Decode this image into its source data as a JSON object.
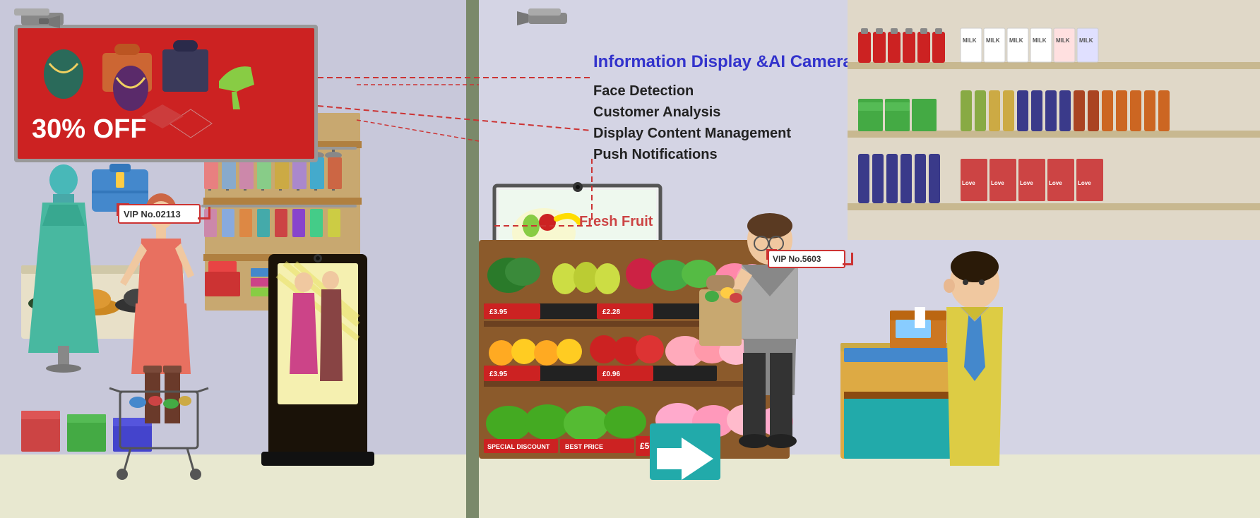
{
  "left_panel": {
    "bg_color": "#c8c8da",
    "floor_color": "#e8e8d0",
    "discount_text": "30% OFF",
    "vip_text": "VIP No.02113",
    "features_label": "Information Display &AI Camera"
  },
  "right_panel": {
    "bg_color": "#d4d4e4",
    "floor_color": "#e4e4d4",
    "vip_text": "VIP No.5603",
    "fresh_fruit_text": "Fresh Fruit"
  },
  "info_box": {
    "title": "Information Display &AI Camera",
    "features": [
      "Face Detection",
      "Customer Analysis",
      "Display Content Management",
      "Push Notifications"
    ]
  }
}
